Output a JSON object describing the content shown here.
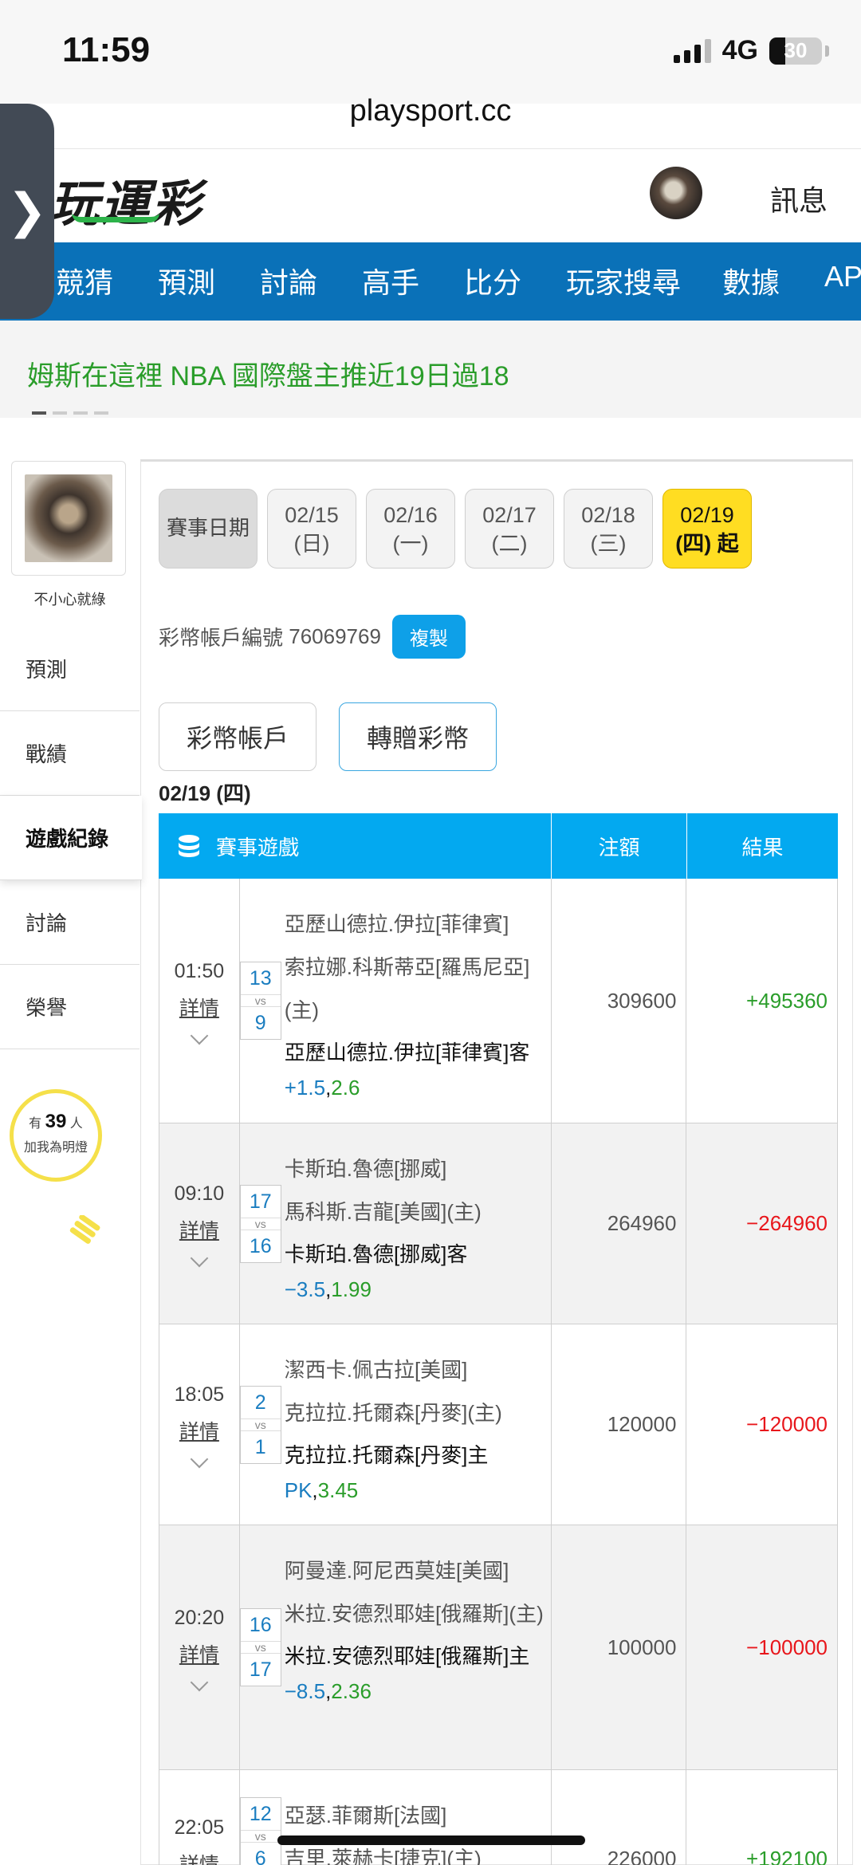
{
  "status": {
    "time": "11:59",
    "network": "4G",
    "battery": "30"
  },
  "browser": {
    "url": "playsport.cc"
  },
  "header": {
    "logo_text": "玩運彩",
    "messages_label": "訊息"
  },
  "nav": {
    "items": [
      "競猜",
      "預測",
      "討論",
      "高手",
      "比分",
      "玩家搜尋",
      "數據",
      "AP"
    ]
  },
  "ticker": {
    "text": "姆斯在這裡 NBA 國際盤主推近19日過18"
  },
  "sidebar": {
    "username": "不小心就綠",
    "menu": [
      "預測",
      "戰績",
      "遊戲紀錄",
      "討論",
      "榮譽"
    ],
    "bulb": {
      "prefix": "有",
      "count": "39",
      "suffix": "人",
      "line2": "加我為明燈"
    }
  },
  "dates": {
    "label": "賽事日期",
    "items": [
      {
        "date": "02/15",
        "day": "(日)"
      },
      {
        "date": "02/16",
        "day": "(一)"
      },
      {
        "date": "02/17",
        "day": "(二)"
      },
      {
        "date": "02/18",
        "day": "(三)"
      },
      {
        "date": "02/19",
        "day": "(四) 起"
      }
    ]
  },
  "account": {
    "label": "彩幣帳戶編號",
    "number": "76069769",
    "copy_label": "複製"
  },
  "tabs": {
    "account": "彩幣帳戶",
    "transfer": "轉贈彩幣"
  },
  "day_title": "02/19 (四)",
  "table": {
    "headers": {
      "game": "賽事遊戲",
      "amount": "注額",
      "result": "結果"
    },
    "detail_label": "詳情",
    "vs_label": "vs",
    "rows": [
      {
        "time": "01:50",
        "score_a": "13",
        "score_b": "9",
        "team_a": "亞歷山德拉.伊拉[菲律賓]",
        "team_b": "索拉娜.科斯蒂亞[羅馬尼亞](主)",
        "pick": "亞歷山德拉.伊拉[菲律賓]客",
        "handicap": "+1.5",
        "sep": ",",
        "odds": "2.6",
        "amount": "309600",
        "result": "+495360"
      },
      {
        "time": "09:10",
        "score_a": "17",
        "score_b": "16",
        "team_a": "卡斯珀.魯德[挪威]",
        "team_b": "馬科斯.吉龍[美國](主)",
        "pick": "卡斯珀.魯德[挪威]客",
        "handicap": "−3.5",
        "sep": ",",
        "odds": "1.99",
        "amount": "264960",
        "result": "−264960"
      },
      {
        "time": "18:05",
        "score_a": "2",
        "score_b": "1",
        "team_a": "潔西卡.佩古拉[美國]",
        "team_b": "克拉拉.托爾森[丹麥](主)",
        "pick": "克拉拉.托爾森[丹麥]主",
        "handicap": "PK",
        "sep": ",",
        "odds": "3.45",
        "amount": "120000",
        "result": "−120000"
      },
      {
        "time": "20:20",
        "score_a": "16",
        "score_b": "17",
        "team_a": "阿曼達.阿尼西莫娃[美國]",
        "team_b": "米拉.安德烈耶娃[俄羅斯](主)",
        "pick": "米拉.安德烈耶娃[俄羅斯]主",
        "handicap": "−8.5",
        "sep": ",",
        "odds": "2.36",
        "amount": "100000",
        "result": "−100000"
      },
      {
        "time": "22:05",
        "score_a": "12",
        "score_b": "6",
        "team_a": "亞瑟.菲爾斯[法國]",
        "team_b": "吉里.萊赫卡[捷克](主)",
        "pick": "",
        "handicap": "",
        "sep": "",
        "odds": "",
        "amount": "226000",
        "result": "+192100"
      }
    ]
  },
  "colors": {
    "nav_blue": "#0a71b8",
    "table_head": "#03a9f0",
    "win": "#2a9d2a",
    "lose": "#e8161b",
    "date_active": "#ffdd22"
  }
}
